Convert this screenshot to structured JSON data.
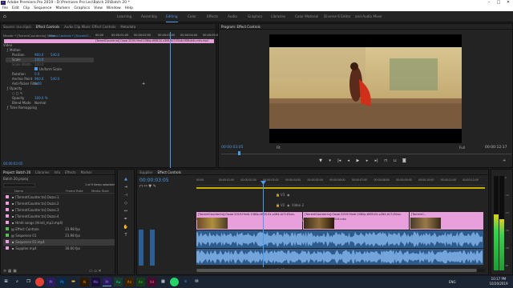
{
  "window": {
    "title": "Adobe Premiere Pro 2019 - D:\\Premiere Pro Lec\\Batch 20\\Batch 20 *",
    "app_icon": "Pr",
    "controls": [
      "–",
      "□",
      "✕"
    ]
  },
  "menu": [
    "File",
    "Edit",
    "Clip",
    "Sequence",
    "Markers",
    "Graphics",
    "View",
    "Window",
    "Help"
  ],
  "workspaces": {
    "home_icon": "home-icon",
    "items": [
      "Learning",
      "Assembly",
      "Editing",
      "Color",
      "Effects",
      "Audio",
      "Graphics",
      "Libraries",
      "Color Material",
      "Diverse 6 Editor",
      "and Audio Mixer"
    ],
    "active": "Editing"
  },
  "effect_controls": {
    "tabs": [
      "Source: (no clips)",
      "Effect Controls",
      "Audio Clip Mixer: Effect Controls",
      "Metadata"
    ],
    "master_label": "Master * [TorrentCounter.to] Oozai...",
    "clip_label": "Effect Controls * [TorrentC...",
    "timecodes": [
      "00:00",
      "00:00:01:00",
      "00:00:02:00",
      "00:00:03:00",
      "00:00:04:00",
      "00:00:05:00"
    ],
    "clip_bar": "[TorrentCounter.to].Oozai.2019.Hindi.1080p.WEB-DL.x264.AC3.ESub-HDHub4u.mkv.mp4",
    "section_video": "Video",
    "rows": [
      {
        "label": "Motion",
        "value": "",
        "v2": ""
      },
      {
        "label": "Position",
        "value": "960.0",
        "v2": "540.0"
      },
      {
        "label": "Scale",
        "value": "100.0",
        "v2": ""
      },
      {
        "label": "Scale Width",
        "value": "100.0",
        "v2": ""
      },
      {
        "label": "",
        "value": "Uniform Scale",
        "v2": ""
      },
      {
        "label": "Rotation",
        "value": "0.0",
        "v2": ""
      },
      {
        "label": "Anchor Point",
        "value": "960.0",
        "v2": "540.0"
      },
      {
        "label": "Anti-flicker Filter",
        "value": "0.00",
        "v2": ""
      },
      {
        "label": "Opacity",
        "value": "",
        "v2": ""
      },
      {
        "label": "",
        "value": "",
        "v2": ""
      },
      {
        "label": "Opacity",
        "value": "100.0 %",
        "v2": ""
      },
      {
        "label": "Blend Mode",
        "value": "Normal",
        "v2": ""
      },
      {
        "label": "Time Remapping",
        "value": "",
        "v2": ""
      }
    ],
    "current_time": "00:00:03:05"
  },
  "program_monitor": {
    "tab": "Program: Effect Controls",
    "timecode": "00:00:03:05",
    "fit": "Fit",
    "quality": "Full",
    "duration": "00:00:12:17",
    "controls": [
      "mark-in-icon",
      "mark-out-icon",
      "go-to-in-icon",
      "step-back-icon",
      "play-icon",
      "step-forward-icon",
      "go-to-out-icon",
      "insert-icon",
      "overwrite-icon",
      "export-frame-icon",
      "settings-icon"
    ]
  },
  "project": {
    "tabs": [
      "Project: Batch 20",
      "Libraries",
      "Info",
      "Effects",
      "Marker"
    ],
    "path": "Batch 20.prproj",
    "selection": "1 of 9 items selected",
    "columns": [
      "Name",
      "Frame Rate",
      "Media Start"
    ],
    "items": [
      {
        "name": "[TorrentCounter.to].Oozai.1",
        "rate": "",
        "start": ""
      },
      {
        "name": "[TorrentCounter.to].Oozai.2",
        "rate": "",
        "start": ""
      },
      {
        "name": "[TorrentCounter.to].Oozai.3",
        "rate": "",
        "start": ""
      },
      {
        "name": "[TorrentCounter.to].Oozai.4",
        "rate": "",
        "start": ""
      },
      {
        "name": "Hindi songs (Hindi_mp3.mp4)",
        "rate": "",
        "start": ""
      },
      {
        "name": "Effect Controls",
        "rate": "23.98 fps",
        "start": ""
      },
      {
        "name": "Sequence 01",
        "rate": "23.98 fps",
        "start": ""
      },
      {
        "name": "Sequence 01.mp4",
        "rate": "",
        "start": ""
      },
      {
        "name": "Supplier.mp4",
        "rate": "30.00 fps",
        "start": ""
      }
    ]
  },
  "timeline": {
    "tabs": [
      "Supplier",
      "Effect Controls"
    ],
    "timecode": "00:00:03:05",
    "ruler": [
      "00:00",
      "00:00:01:00",
      "00:00:02:00",
      "00:00:03:00",
      "00:00:04:00",
      "00:00:05:00",
      "00:00:06:00",
      "00:00:07:00",
      "00:00:08:00",
      "00:00:09:00",
      "00:00:10:00",
      "00:00:11:00",
      "00:00:12:00"
    ],
    "tracks": {
      "v3": "V3",
      "v2": "V2",
      "v1": "V1",
      "a1": "A1",
      "a2": "A2",
      "a3": "A3",
      "v1_name": "Video 1",
      "a1_name": "Audio 1",
      "v2_name": "Video 2"
    },
    "clips": [
      {
        "label": "[TorrentCounter.to].Oozai.2019.Hindi.1080p.WEB-DL.x264.AC3.ESub-HDHub4u_2019.mkv"
      },
      {
        "label": "[TorrentCounter.to].Oozai.2019.Hindi.1080p.WEB-DL.x264.AC3.ESub-HDHub4u_snapchat_2019.mkv"
      },
      {
        "label": "[TorrentC..."
      }
    ],
    "meter_labels": [
      "0",
      "-12",
      "-24",
      "-36",
      "-48",
      "dB"
    ]
  },
  "tools": [
    "select-icon",
    "track-select-icon",
    "ripple-edit-icon",
    "razor-icon",
    "slip-icon",
    "pen-icon",
    "hand-icon",
    "type-icon"
  ],
  "taskbar": {
    "apps": [
      "windows-icon",
      "search-icon",
      "task-view-icon",
      "chrome-icon",
      "premiere-icon",
      "photoshop-icon",
      "folder-icon",
      "illustrator-icon",
      "media-encoder-icon",
      "audition-icon",
      "whatsapp-icon",
      "edge-icon",
      "calculator-icon",
      "mail-icon"
    ],
    "clock": "10:17 PM",
    "date": "10/20/2019",
    "lang": "ENG"
  },
  "colors": {
    "accent": "#4d9be8",
    "clip_pink": "#e8a0dc",
    "audio_blue": "#2e5a8c",
    "playhead": "#4d9be8"
  }
}
